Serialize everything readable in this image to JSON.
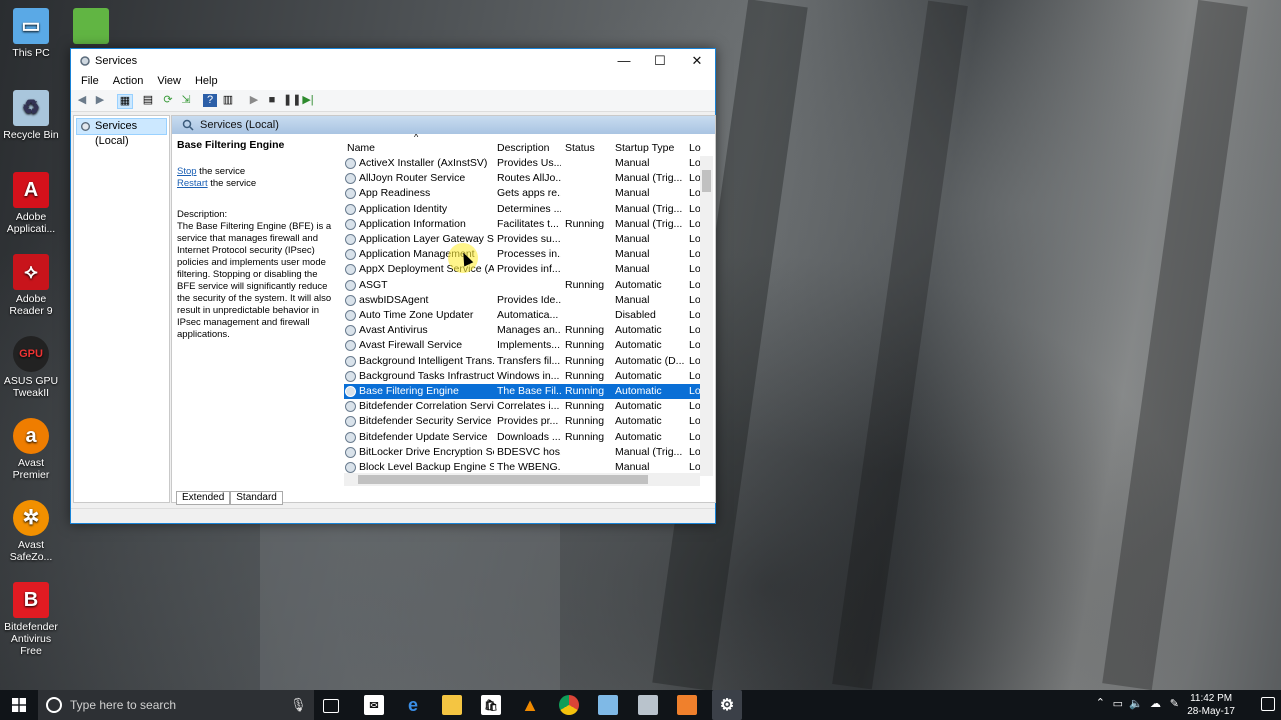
{
  "desktop": {
    "icons": [
      {
        "label": "This PC",
        "icon": "computer-icon",
        "color": "#5aa9e6"
      },
      {
        "label": "",
        "icon": "bluestacks-icon",
        "color": "#61b543"
      },
      {
        "label": "Recycle Bin",
        "icon": "recycle-bin-icon",
        "color": "#a9c6dc"
      },
      {
        "label": "Adobe Applicati...",
        "icon": "adobe-app-icon",
        "color": "#d4111b"
      },
      {
        "label": "Adobe Reader 9",
        "icon": "adobe-reader-icon",
        "color": "#c8141b"
      },
      {
        "label": "ASUS GPU TweakII",
        "icon": "asus-gpu-icon",
        "color": "#222222"
      },
      {
        "label": "Avast Premier",
        "icon": "avast-icon",
        "color": "#ef7d00"
      },
      {
        "label": "Avast SafeZo...",
        "icon": "avast-safezone-icon",
        "color": "#f29000"
      },
      {
        "label": "Bitdefender Antivirus Free",
        "icon": "bitdefender-icon",
        "color": "#e11b22"
      }
    ]
  },
  "window": {
    "title": "Services",
    "menu": [
      "File",
      "Action",
      "View",
      "Help"
    ],
    "tree_node": "Services (Local)",
    "pane_title": "Services (Local)",
    "detail": {
      "service_name": "Base Filtering Engine",
      "stop_link": "Stop",
      "stop_suffix": " the service",
      "restart_link": "Restart",
      "restart_suffix": " the service",
      "description_label": "Description:",
      "description": "The Base Filtering Engine (BFE) is a service that manages firewall and Internet Protocol security (IPsec) policies and implements user mode filtering. Stopping or disabling the BFE service will significantly reduce the security of the system. It will also result in unpredictable behavior in IPsec management and firewall applications."
    },
    "columns": {
      "name": "Name",
      "description": "Description",
      "status": "Status",
      "startup": "Startup Type",
      "logon": "Lo"
    },
    "rows": [
      {
        "name": "ActiveX Installer (AxInstSV)",
        "description": "Provides Us...",
        "status": "",
        "startup": "Manual",
        "logon": "Lo"
      },
      {
        "name": "AllJoyn Router Service",
        "description": "Routes AllJo...",
        "status": "",
        "startup": "Manual (Trig...",
        "logon": "Lo"
      },
      {
        "name": "App Readiness",
        "description": "Gets apps re...",
        "status": "",
        "startup": "Manual",
        "logon": "Lo"
      },
      {
        "name": "Application Identity",
        "description": "Determines ...",
        "status": "",
        "startup": "Manual (Trig...",
        "logon": "Lo"
      },
      {
        "name": "Application Information",
        "description": "Facilitates t...",
        "status": "Running",
        "startup": "Manual (Trig...",
        "logon": "Lo"
      },
      {
        "name": "Application Layer Gateway S...",
        "description": "Provides su...",
        "status": "",
        "startup": "Manual",
        "logon": "Lo"
      },
      {
        "name": "Application Management",
        "description": "Processes in...",
        "status": "",
        "startup": "Manual",
        "logon": "Lo"
      },
      {
        "name": "AppX Deployment Service (A...",
        "description": "Provides inf...",
        "status": "",
        "startup": "Manual",
        "logon": "Lo"
      },
      {
        "name": "ASGT",
        "description": "",
        "status": "Running",
        "startup": "Automatic",
        "logon": "Lo"
      },
      {
        "name": "aswbIDSAgent",
        "description": "Provides Ide...",
        "status": "",
        "startup": "Manual",
        "logon": "Lo"
      },
      {
        "name": "Auto Time Zone Updater",
        "description": "Automatica...",
        "status": "",
        "startup": "Disabled",
        "logon": "Lo"
      },
      {
        "name": "Avast Antivirus",
        "description": "Manages an...",
        "status": "Running",
        "startup": "Automatic",
        "logon": "Lo"
      },
      {
        "name": "Avast Firewall Service",
        "description": "Implements...",
        "status": "Running",
        "startup": "Automatic",
        "logon": "Lo"
      },
      {
        "name": "Background Intelligent Trans...",
        "description": "Transfers fil...",
        "status": "Running",
        "startup": "Automatic (D...",
        "logon": "Lo"
      },
      {
        "name": "Background Tasks Infrastruct...",
        "description": "Windows in...",
        "status": "Running",
        "startup": "Automatic",
        "logon": "Lo"
      },
      {
        "name": "Base Filtering Engine",
        "description": "The Base Fil...",
        "status": "Running",
        "startup": "Automatic",
        "logon": "Lo",
        "selected": true
      },
      {
        "name": "Bitdefender Correlation Service",
        "description": "Correlates i...",
        "status": "Running",
        "startup": "Automatic",
        "logon": "Lo"
      },
      {
        "name": "Bitdefender Security Service",
        "description": "Provides pr...",
        "status": "Running",
        "startup": "Automatic",
        "logon": "Lo"
      },
      {
        "name": "Bitdefender Update Service",
        "description": "Downloads ...",
        "status": "Running",
        "startup": "Automatic",
        "logon": "Lo"
      },
      {
        "name": "BitLocker Drive Encryption Se...",
        "description": "BDESVC hos...",
        "status": "",
        "startup": "Manual (Trig...",
        "logon": "Lo"
      },
      {
        "name": "Block Level Backup Engine S...",
        "description": "The WBENG...",
        "status": "",
        "startup": "Manual",
        "logon": "Lo"
      }
    ],
    "tabs": [
      "Extended",
      "Standard"
    ]
  },
  "taskbar": {
    "search_placeholder": "Type here to search",
    "time": "11:42 PM",
    "date": "28-May-17"
  },
  "colors": {
    "selection": "#0a6fd6",
    "accent": "#1883d7"
  }
}
